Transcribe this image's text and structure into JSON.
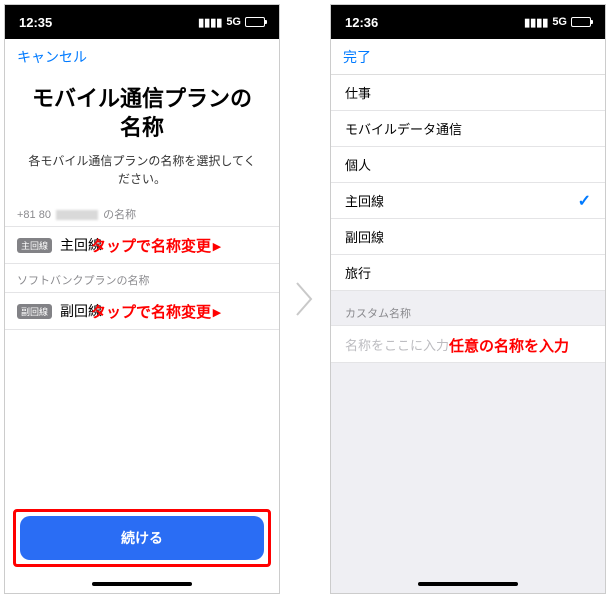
{
  "left": {
    "status": {
      "time": "12:35",
      "net": "5G"
    },
    "nav": {
      "cancel": "キャンセル"
    },
    "title": "モバイル通信プランの名称",
    "subtitle": "各モバイル通信プランの名称を選択してください。",
    "section1_prefix": "+81 80",
    "section1_suffix": "の名称",
    "row1": {
      "badge": "主回線",
      "label": "主回線"
    },
    "section2": "ソフトバンクプランの名称",
    "row2": {
      "badge": "副回線",
      "label": "副回線"
    },
    "continue": "続ける"
  },
  "right": {
    "status": {
      "time": "12:36",
      "net": "5G"
    },
    "nav": {
      "done": "完了"
    },
    "options": [
      "仕事",
      "モバイルデータ通信",
      "個人",
      "主回線",
      "副回線",
      "旅行"
    ],
    "selected_index": 3,
    "custom_label": "カスタム名称",
    "custom_placeholder": "名称をここに入力"
  },
  "annotations": {
    "tap_rename": "タップで名称変更",
    "enter_any": "任意の名称を入力"
  }
}
